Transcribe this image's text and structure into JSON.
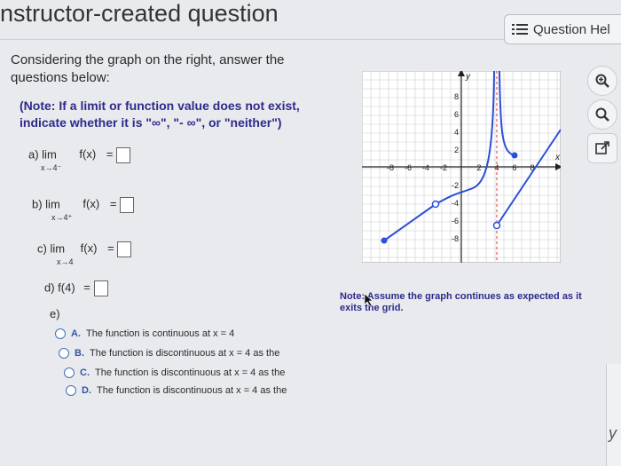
{
  "header": {
    "title": "nstructor-created question",
    "help_label": "Question Hel"
  },
  "intro": "Considering the graph on the right, answer the questions below:",
  "note": "(Note: If a limit or function value does not exist, indicate whether it is \"∞\", \"- ∞\", or \"neither\")",
  "parts": {
    "a": {
      "label": "a) lim",
      "func": "f(x)",
      "sub": "x→4⁻",
      "eq": "="
    },
    "b": {
      "label": "b) lim",
      "func": "f(x)",
      "sub": "x→4⁺",
      "eq": "="
    },
    "c": {
      "label": "c) lim",
      "func": "f(x)",
      "sub": "x→4",
      "eq": "="
    },
    "d": {
      "label": "d) f(4)",
      "eq": "="
    },
    "e": {
      "label": "e)"
    }
  },
  "choices": [
    {
      "letter": "A.",
      "text": "The function is continuous at x = 4"
    },
    {
      "letter": "B.",
      "text": "The function is discontinuous at x = 4 as the"
    },
    {
      "letter": "C.",
      "text": "The function is discontinuous at x = 4 as the"
    },
    {
      "letter": "D.",
      "text": "The function is discontinuous at x = 4 as the"
    }
  ],
  "graph": {
    "x_label": "x",
    "y_label": "y",
    "x_ticks": [
      "-8",
      "-6",
      "-4",
      "-2",
      "2",
      "4",
      "6",
      "8"
    ],
    "y_ticks": [
      "8",
      "6",
      "4",
      "2",
      "-2",
      "-4",
      "-6",
      "-8"
    ]
  },
  "graph_note": "Note: Assume the graph continues as expected as it exits the grid.",
  "edge_text": "y",
  "icons": [
    "list-icon",
    "zoom-in-icon",
    "zoom-out-icon",
    "external-link-icon",
    "cursor-icon"
  ]
}
